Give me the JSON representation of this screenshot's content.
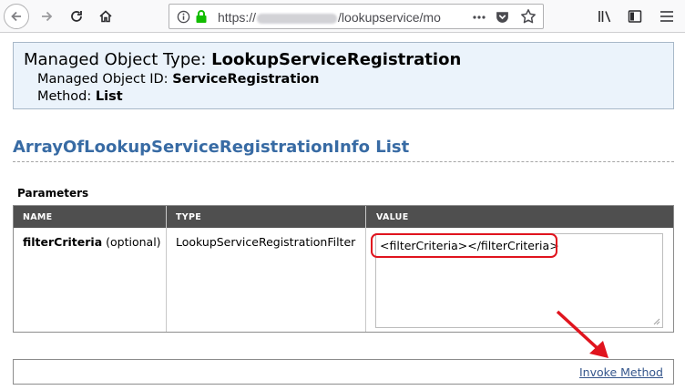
{
  "browser": {
    "url_prefix": "https://",
    "url_path": "/lookupservice/mo",
    "colors": {
      "secure_lock": "#12bc00",
      "toolbar_bg": "#f9f9fa"
    }
  },
  "managed_object": {
    "type_label": "Managed Object Type:",
    "type_value": "LookupServiceRegistration",
    "id_label": "Managed Object ID:",
    "id_value": "ServiceRegistration",
    "method_label": "Method:",
    "method_value": "List"
  },
  "section": {
    "title": "ArrayOfLookupServiceRegistrationInfo List",
    "title_color": "#386ba4"
  },
  "parameters": {
    "label": "Parameters",
    "columns": [
      "NAME",
      "TYPE",
      "VALUE"
    ],
    "rows": [
      {
        "name": "filterCriteria",
        "qualifier": "(optional)",
        "type": "LookupServiceRegistrationFilter",
        "value": "<filterCriteria></filterCriteria>"
      }
    ]
  },
  "actions": {
    "invoke_label": "Invoke Method"
  },
  "annotations": {
    "highlight_color": "#e0141e"
  }
}
